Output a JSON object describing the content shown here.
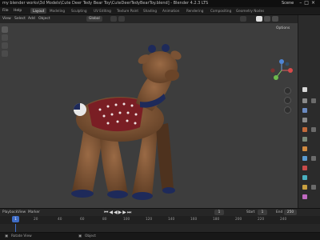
{
  "window": {
    "title": "my blender works\\3d Models\\Cute Deer Tedy Bear Toy\\CuteDeerTedyBearToy.blend] - Blender 4.2.3 LTS",
    "scene_label": "Scene"
  },
  "menubar": {
    "file": "File",
    "help": "Help",
    "tabs": [
      "Layout",
      "Modeling",
      "Sculpting",
      "UV Editing",
      "Texture Paint",
      "Shading",
      "Animation",
      "Rendering",
      "Compositing",
      "Geometry Nodes"
    ]
  },
  "viewport_header": {
    "view": "View",
    "select": "Select",
    "add": "Add",
    "object": "Object",
    "transform_orientation": "Global",
    "options": "Options"
  },
  "timeline": {
    "playback": "Playback",
    "view": "View",
    "marker": "Marker",
    "start_label": "Start",
    "start_value": "1",
    "end_label": "End",
    "end_value": "250",
    "current_frame": "1",
    "ruler_ticks": [
      "1",
      "20",
      "40",
      "60",
      "80",
      "100",
      "120",
      "140",
      "160",
      "180",
      "200",
      "220",
      "240"
    ]
  },
  "statusbar": {
    "rotate_view": "Rotate View",
    "object": "Object"
  },
  "icons": [
    "close-icon",
    "maximize-icon",
    "minimize-icon",
    "cursor-icon",
    "move-icon",
    "rotate-icon",
    "scale-icon",
    "hand-icon",
    "camera-icon",
    "zoom-icon",
    "gizmo-icon"
  ]
}
